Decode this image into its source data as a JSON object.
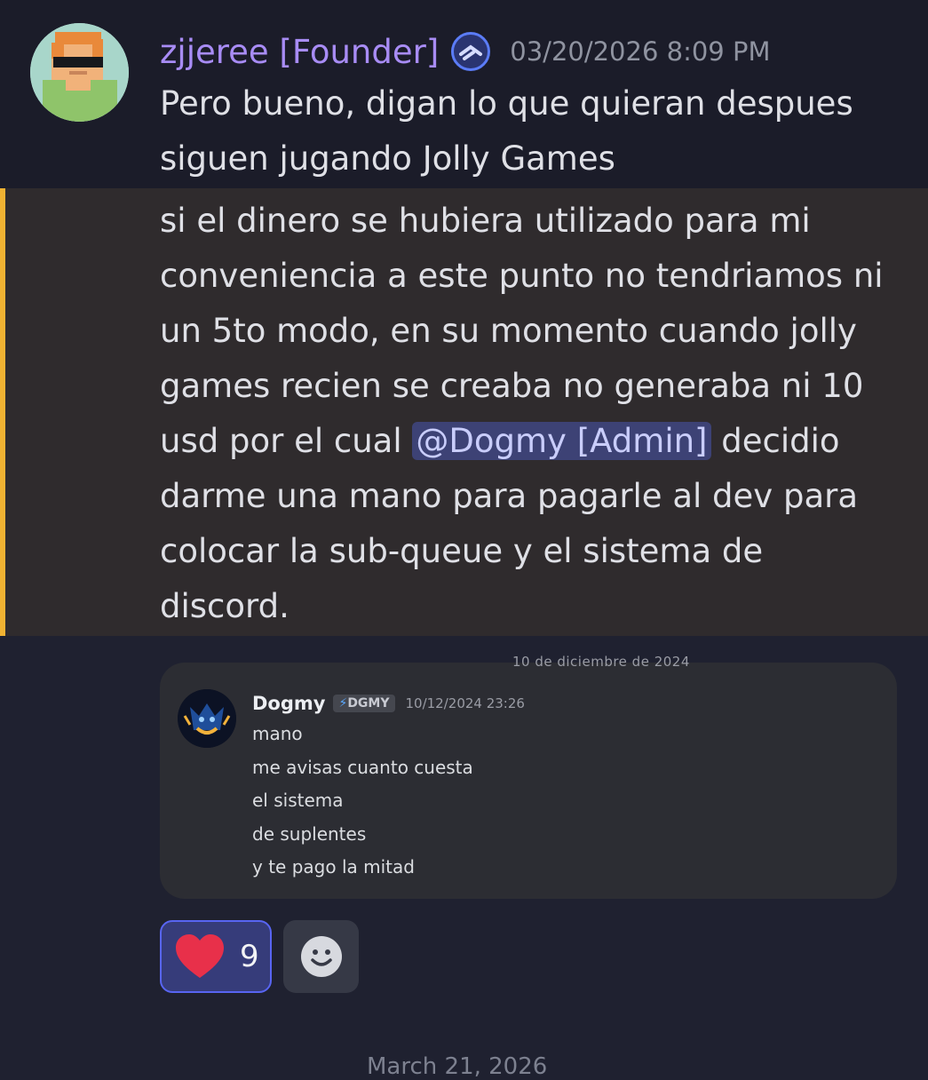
{
  "message1": {
    "author": "zjjeree [Founder]",
    "timestamp": "03/20/2026 8:09 PM",
    "lines": [
      "Pero bueno, digan lo que quieran despues",
      "siguen jugando Jolly Games"
    ]
  },
  "message2": {
    "lines": [
      "si el dinero se hubiera utilizado para mi",
      "conveniencia a este punto no tendriamos ni",
      "un 5to modo, en su momento cuando jolly",
      "games recien se creaba no generaba ni 10"
    ],
    "line5_before": "usd por el cual ",
    "mention": "@Dogmy [Admin]",
    "line5_after": " decidio",
    "lines_after": [
      "darme una mano para pagarle al dev para",
      "colocar la sub-queue y el sistema de",
      "discord."
    ]
  },
  "embed": {
    "date_label": "10 de diciembre de 2024",
    "author": "Dogmy",
    "tag": "DGMY",
    "tag_icon": "⚡",
    "timestamp": "10/12/2024 23:26",
    "lines": [
      "mano",
      "me avisas cuanto cuesta",
      "el sistema",
      "de suplentes",
      "y te pago la mitad"
    ]
  },
  "reactions": [
    {
      "emoji": "heart-icon",
      "count": "9"
    }
  ],
  "next_date": "March 21, 2026",
  "colors": {
    "author": "#a88cf5",
    "mention_bg": "#3d4275",
    "highlight_bar": "#f0b232",
    "reaction_border": "#5865f2"
  }
}
